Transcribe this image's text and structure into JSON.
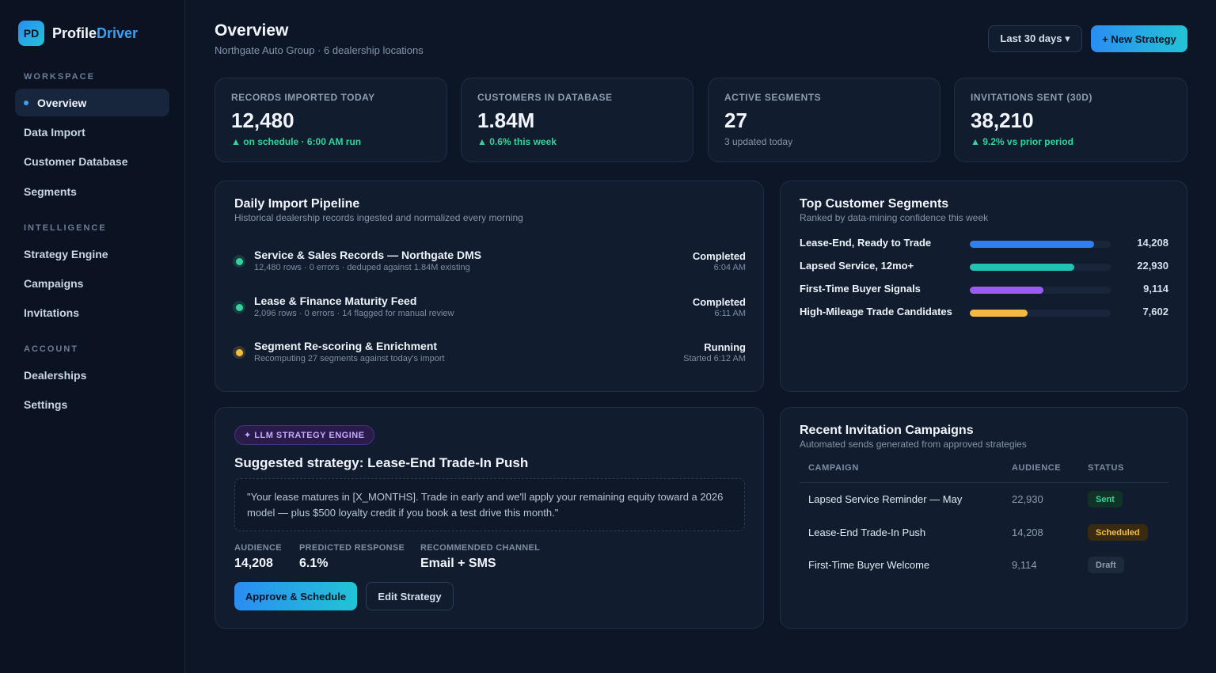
{
  "brand": {
    "logo": "PD",
    "name_part1": "Profile",
    "name_part2": "Driver"
  },
  "sidebar": {
    "sections": [
      {
        "title": "WORKSPACE",
        "items": [
          "Overview",
          "Data Import",
          "Customer Database",
          "Segments"
        ]
      },
      {
        "title": "INTELLIGENCE",
        "items": [
          "Strategy Engine",
          "Campaigns",
          "Invitations"
        ]
      },
      {
        "title": "ACCOUNT",
        "items": [
          "Dealerships",
          "Settings"
        ]
      }
    ],
    "active": "Overview"
  },
  "header": {
    "title": "Overview",
    "subtitle": "Northgate Auto Group · 6 dealership locations",
    "range_label": "Last 30 days ▾",
    "new_button": "+ New Strategy"
  },
  "stats": [
    {
      "label": "RECORDS IMPORTED TODAY",
      "value": "12,480",
      "sub": "▲ on schedule · 6:00 AM run",
      "tone": "positive"
    },
    {
      "label": "CUSTOMERS IN DATABASE",
      "value": "1.84M",
      "sub": "▲ 0.6% this week",
      "tone": "positive"
    },
    {
      "label": "ACTIVE SEGMENTS",
      "value": "27",
      "sub": "3 updated today",
      "tone": "muted"
    },
    {
      "label": "INVITATIONS SENT (30D)",
      "value": "38,210",
      "sub": "▲ 9.2% vs prior period",
      "tone": "positive"
    }
  ],
  "pipeline": {
    "title": "Daily Import Pipeline",
    "subtitle": "Historical dealership records ingested and normalized every morning",
    "rows": [
      {
        "name": "Service & Sales Records — Northgate DMS",
        "meta": "12,480 rows · 0 errors · deduped against 1.84M existing",
        "status": "Completed",
        "time": "6:04 AM",
        "state": "green"
      },
      {
        "name": "Lease & Finance Maturity Feed",
        "meta": "2,096 rows · 0 errors · 14 flagged for manual review",
        "status": "Completed",
        "time": "6:11 AM",
        "state": "green"
      },
      {
        "name": "Segment Re-scoring & Enrichment",
        "meta": "Recomputing 27 segments against today's import",
        "status": "Running",
        "time": "Started 6:12 AM",
        "state": "yellow"
      }
    ]
  },
  "segments": {
    "title": "Top Customer Segments",
    "subtitle": "Ranked by data-mining confidence this week",
    "rows": [
      {
        "name": "Lease-End, Ready to Trade",
        "value": "14,208",
        "level": 0.88,
        "color": "#2f7ff0"
      },
      {
        "name": "Lapsed Service, 12mo+",
        "value": "22,930",
        "level": 0.74,
        "color": "#1fc4b4"
      },
      {
        "name": "First-Time Buyer Signals",
        "value": "9,114",
        "level": 0.52,
        "color": "#9b5cf6"
      },
      {
        "name": "High-Mileage Trade Candidates",
        "value": "7,602",
        "level": 0.41,
        "color": "#f5b942"
      }
    ]
  },
  "strategy": {
    "badge": "✦ LLM STRATEGY ENGINE",
    "title": "Suggested strategy: Lease-End Trade-In Push",
    "quote": "\"Your lease matures in [X_MONTHS]. Trade in early and we'll apply your remaining equity toward a 2026 model — plus $500 loyalty credit if you book a test drive this month.\"",
    "metrics": [
      {
        "label": "AUDIENCE",
        "value": "14,208"
      },
      {
        "label": "PREDICTED RESPONSE",
        "value": "6.1%"
      },
      {
        "label": "RECOMMENDED CHANNEL",
        "value": "Email + SMS"
      }
    ],
    "approve_label": "Approve & Schedule",
    "edit_label": "Edit Strategy"
  },
  "campaigns": {
    "title": "Recent Invitation Campaigns",
    "subtitle": "Automated sends generated from approved strategies",
    "headers": [
      "CAMPAIGN",
      "AUDIENCE",
      "STATUS"
    ],
    "rows": [
      {
        "name": "Lapsed Service Reminder — May",
        "audience": "22,930",
        "status": "Sent",
        "kind": "sent"
      },
      {
        "name": "Lease-End Trade-In Push",
        "audience": "14,208",
        "status": "Scheduled",
        "kind": "scheduled"
      },
      {
        "name": "First-Time Buyer Welcome",
        "audience": "9,114",
        "status": "Draft",
        "kind": "draft"
      }
    ]
  }
}
